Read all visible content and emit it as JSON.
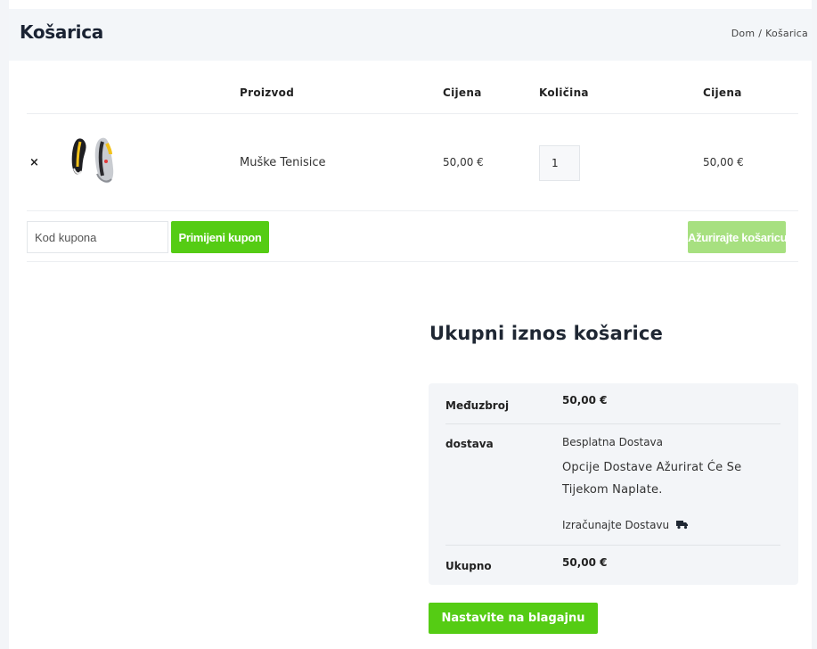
{
  "page": {
    "title": "Košarica",
    "breadcrumb": {
      "home": "Dom",
      "separator": "/",
      "current": "Košarica"
    }
  },
  "cart": {
    "columns": {
      "product": "Proizvod",
      "price": "Cijena",
      "quantity": "Količina",
      "subtotal": "Cijena"
    },
    "items": [
      {
        "remove_icon": "×",
        "thumbnail_icon": "sneaker-image",
        "name": "Muške Tenisice",
        "price": "50,00 €",
        "quantity": "1",
        "subtotal": "50,00 €"
      }
    ],
    "coupon": {
      "placeholder": "Kod kupona",
      "apply_label": "Primijeni kupon"
    },
    "update_label": "Ažurirajte košaricu"
  },
  "totals": {
    "title": "Ukupni iznos košarice",
    "subtotal_label": "Međuzbroj",
    "subtotal_value": "50,00 €",
    "shipping_label": "dostava",
    "shipping_method": "Besplatna Dostava",
    "shipping_note": "Opcije Dostave Ažurirat Će Se Tijekom Naplate.",
    "calculate_shipping": "Izračunajte Dostavu",
    "total_label": "Ukupno",
    "total_value": "50,00 €",
    "checkout_label": "Nastavite na blagajnu"
  },
  "colors": {
    "accent": "#55cc14",
    "accent_disabled": "#a7e080",
    "panel_bg": "#f3f5f8"
  }
}
